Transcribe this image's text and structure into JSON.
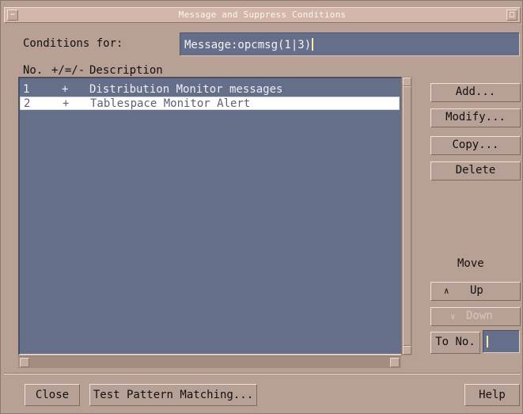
{
  "window": {
    "title": "Message and Suppress Conditions"
  },
  "conditions": {
    "label": "Conditions for:",
    "value": "Message:opcmsg(1|3)"
  },
  "list": {
    "headers": {
      "no": "No.",
      "flag": "+/=/-",
      "description": "Description"
    },
    "rows": [
      {
        "no": "1",
        "flag": "+",
        "description": "Distribution Monitor messages",
        "selected": false
      },
      {
        "no": "2",
        "flag": "+",
        "description": "Tablespace Monitor Alert",
        "selected": true
      }
    ]
  },
  "actions": {
    "add": "Add...",
    "modify": "Modify...",
    "copy": "Copy...",
    "delete": "Delete"
  },
  "move": {
    "label": "Move",
    "up": "Up",
    "down": "Down",
    "to_no": "To No."
  },
  "footer": {
    "close": "Close",
    "test": "Test Pattern Matching...",
    "help": "Help"
  },
  "icons": {
    "window_menu": "window-menu-icon",
    "maximize": "maximize-icon",
    "up_arrow": "up-arrow-icon",
    "down_arrow": "down-arrow-icon"
  },
  "colors": {
    "background": "#b8a095",
    "list_background": "#666f8a",
    "selected_row": "#ffffff"
  }
}
